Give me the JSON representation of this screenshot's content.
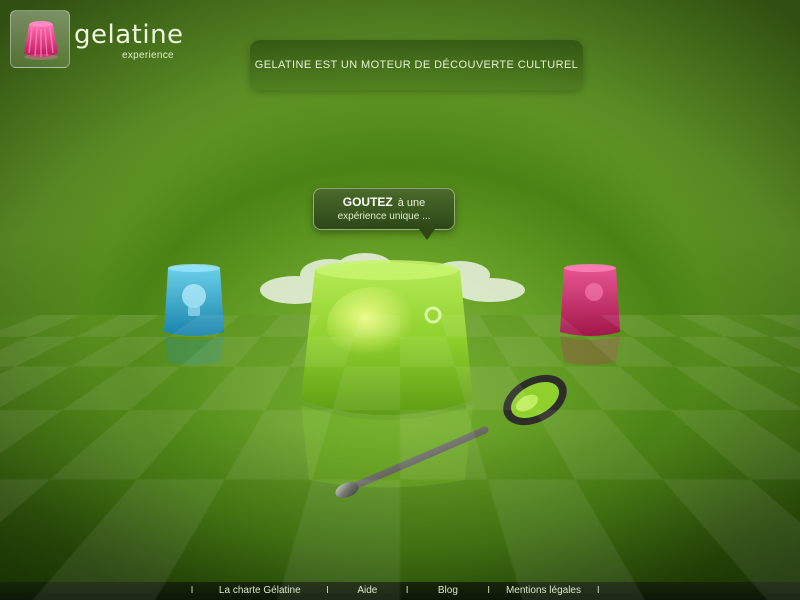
{
  "brand": {
    "title": "gelatine",
    "subtitle": "experience",
    "logo_icon": "pink-jelly-icon",
    "accent_color": "#e0207a"
  },
  "tagline": "GELATINE EST  UN MOTEUR DE DÉCOUVERTE CULTUREL",
  "bubble": {
    "strong": "GOUTEZ",
    "line1_rest": "à une",
    "line2": "expérience unique ..."
  },
  "jellies": [
    {
      "name": "blue-jelly-lightbulb",
      "color": "#29a6d6",
      "icon": "lightbulb-icon"
    },
    {
      "name": "green-jelly-main",
      "color": "#8fd02c"
    },
    {
      "name": "pink-jelly",
      "color": "#d81e6a"
    }
  ],
  "footer": {
    "separator": "I",
    "links": [
      "La charte Gélatine",
      "Aide",
      "Blog",
      "Mentions légales"
    ]
  },
  "colors": {
    "background": "#5f9426",
    "footer": "#0c1806"
  }
}
